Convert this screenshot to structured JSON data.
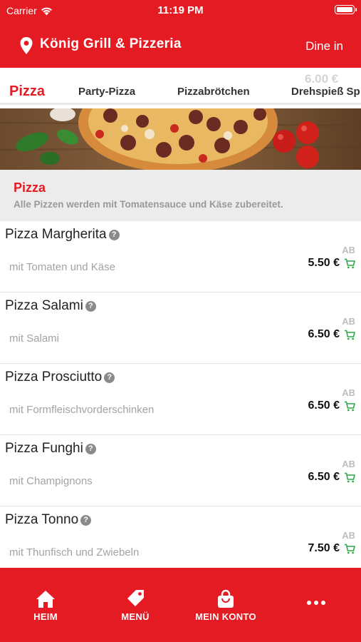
{
  "status_bar": {
    "carrier": "Carrier",
    "time": "11:19 PM"
  },
  "header": {
    "store_name": "König Grill & Pizzeria",
    "mode": "Dine in"
  },
  "tabs": {
    "ghost_price": "6.00 €",
    "items": [
      {
        "label": "Pizza",
        "active": true
      },
      {
        "label": "Party-Pizza",
        "active": false
      },
      {
        "label": "Pizzabrötchen",
        "active": false
      },
      {
        "label": "Drehspieß Sp",
        "active": false
      }
    ]
  },
  "category": {
    "title": "Pizza",
    "description": "Alle Pizzen werden mit Tomatensauce und Käse zubereitet."
  },
  "items": [
    {
      "name": "Pizza Margherita",
      "description": "mit Tomaten und Käse",
      "prefix": "AB",
      "price": "5.50 €"
    },
    {
      "name": "Pizza Salami",
      "description": "mit Salami",
      "prefix": "AB",
      "price": "6.50 €"
    },
    {
      "name": "Pizza Prosciutto",
      "description": "mit Formfleischvorderschinken",
      "prefix": "AB",
      "price": "6.50 €"
    },
    {
      "name": "Pizza Funghi",
      "description": "mit Champignons",
      "prefix": "AB",
      "price": "6.50 €"
    },
    {
      "name": "Pizza Tonno",
      "description": "mit Thunfisch und Zwiebeln",
      "prefix": "AB",
      "price": "7.50 €"
    }
  ],
  "bottom_nav": [
    {
      "label": "HEIM",
      "icon": "home-icon"
    },
    {
      "label": "MENÜ",
      "icon": "tag-icon"
    },
    {
      "label": "MEIN KONTO",
      "icon": "shopping-bag-icon"
    },
    {
      "label": "",
      "icon": "more-icon"
    }
  ],
  "colors": {
    "brand": "#e41b23",
    "cart": "#2ea84a",
    "muted": "#a3a3a3"
  }
}
